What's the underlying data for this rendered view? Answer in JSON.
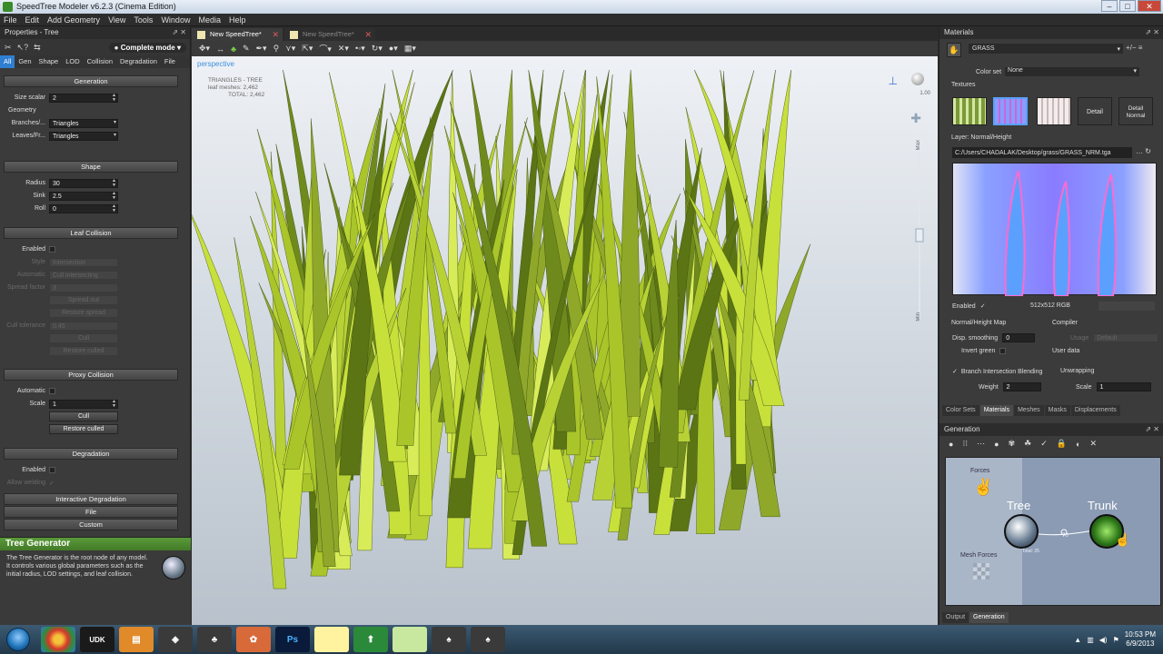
{
  "window": {
    "title": "SpeedTree Modeler v6.2.3 (Cinema Edition)"
  },
  "menu": [
    "File",
    "Edit",
    "Add Geometry",
    "View",
    "Tools",
    "Window",
    "Media",
    "Help"
  ],
  "left_panel": {
    "title": "Properties - Tree",
    "mode": "Complete mode",
    "tabs": [
      "All",
      "Gen",
      "Shape",
      "LOD",
      "Collision",
      "Degradation",
      "File"
    ],
    "generation": {
      "header": "Generation",
      "size_scalar_label": "Size scalar",
      "size_scalar": "2",
      "geometry_label": "Geometry",
      "branches_label": "Branches/...",
      "branches": "Triangles",
      "leaves_label": "Leaves/Fr...",
      "leaves": "Triangles"
    },
    "shape": {
      "header": "Shape",
      "radius_label": "Radius",
      "radius": "30",
      "sink_label": "Sink",
      "sink": "2.5",
      "roll_label": "Roll",
      "roll": "0"
    },
    "leaf_collision": {
      "header": "Leaf Collision",
      "enabled_label": "Enabled",
      "style_label": "Style",
      "style": "Intersection",
      "automatic_label": "Automatic",
      "automatic": "Cull intersecting",
      "spread_label": "Spread factor",
      "spread": "3",
      "spread_out": "Spread out",
      "restore_spread": "Restore spread",
      "cull_tol_label": "Cull tolerance",
      "cull_tol": "0.45",
      "cull": "Cull",
      "restore_culled": "Restore culled"
    },
    "proxy_collision": {
      "header": "Proxy Collision",
      "automatic_label": "Automatic",
      "scale_label": "Scale",
      "scale": "1",
      "cull": "Cull",
      "restore_culled": "Restore culled"
    },
    "degradation": {
      "header": "Degradation",
      "enabled_label": "Enabled",
      "allow_welding_label": "Allow welding"
    },
    "interactive_degradation": "Interactive Degradation",
    "file": "File",
    "custom": "Custom",
    "help": {
      "title": "Tree Generator",
      "body": "The Tree Generator is the root node of any model. It controls various global parameters such as the initial radius, LOD settings, and leaf collision."
    }
  },
  "viewport": {
    "tabs": [
      "New SpeedTree*",
      "New SpeedTree*"
    ],
    "view_label": "perspective",
    "stats_title": "TRIANGLES - TREE",
    "stats_leaf": "leaf meshes: 2,462",
    "stats_total": "TOTAL: 2,462",
    "zoom_max": "Max",
    "zoom_min": "Min",
    "corner_value": "1.00"
  },
  "right_panel": {
    "title": "Materials",
    "material": "GRASS",
    "color_set_label": "Color set",
    "color_set": "None",
    "textures_label": "Textures",
    "tex_detail": "Detail",
    "tex_detail_normal": "Detail Normal",
    "layer_label": "Layer: Normal/Height",
    "path": "C:/Users/CHADALAK/Desktop/grass/GRASS_NRM.tga",
    "enabled_label": "Enabled",
    "resolution": "512x512 RGB",
    "normal_map_label": "Normal/Height Map",
    "compiler_label": "Compiler",
    "disp_smoothing_label": "Disp. smoothing",
    "disp_smoothing": "0",
    "usage_label": "Usage",
    "usage": "Default",
    "invert_green_label": "Invert green",
    "user_data_label": "User data",
    "branch_blend_label": "Branch Intersection Blending",
    "unwrapping_label": "Unwrapping",
    "weight_label": "Weight",
    "weight": "2",
    "scale_label": "Scale",
    "scale": "1",
    "tabs": [
      "Color Sets",
      "Materials",
      "Meshes",
      "Masks",
      "Displacements"
    ],
    "generation_title": "Generation",
    "graph": {
      "forces": "Forces",
      "tree": "Tree",
      "trunk": "Trunk",
      "mesh_forces": "Mesh Forces",
      "connector_value": "70",
      "total": "Total: 25"
    },
    "bottom_tabs": [
      "Output",
      "Generation"
    ]
  },
  "taskbar": {
    "time": "10:53 PM",
    "date": "6/9/2013"
  }
}
